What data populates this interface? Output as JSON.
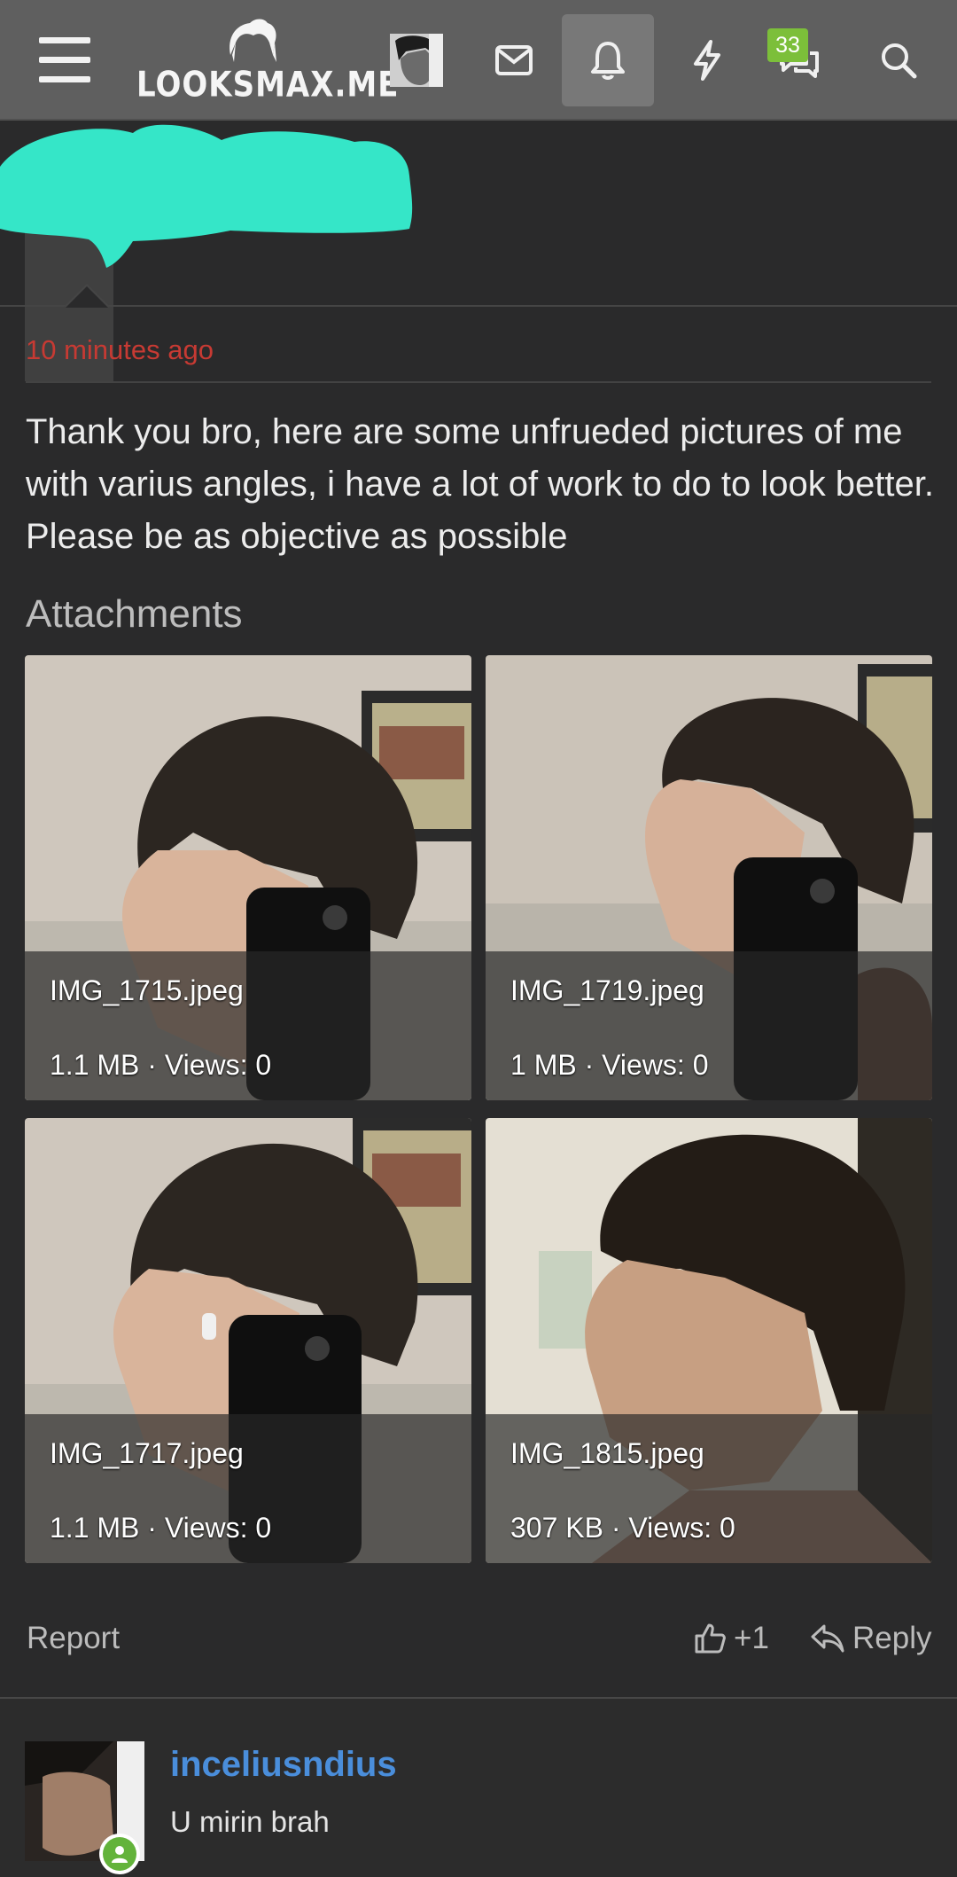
{
  "app": {
    "logo_text": "LOOKSMAX.ME"
  },
  "nav": {
    "icons": [
      "menu-icon",
      "user-avatar",
      "mail-icon",
      "bell-icon",
      "lightning-icon",
      "chat-icon",
      "search-icon"
    ],
    "chat_badge": "33"
  },
  "post": {
    "time": "10 minutes ago",
    "body": "Thank you bro, here are some unfrueded pictures of me with varius angles, i have a lot of work to do to look better. Please be as objective as possible",
    "attachments_title": "Attachments",
    "attachments": [
      {
        "name": "IMG_1715.jpeg",
        "size": "1.1 MB · Views: 0"
      },
      {
        "name": "IMG_1719.jpeg",
        "size": "1 MB · Views: 0"
      },
      {
        "name": "IMG_1717.jpeg",
        "size": "1.1 MB · Views: 0"
      },
      {
        "name": "IMG_1815.jpeg",
        "size": "307 KB · Views: 0"
      }
    ],
    "actions": {
      "report": "Report",
      "like": "+1",
      "reply": "Reply"
    }
  },
  "comment": {
    "username": "inceliusndius",
    "text": "U mirin brah"
  },
  "colors": {
    "accent_red": "#c73a33",
    "username_blue": "#4a8edb",
    "badge_green": "#7cbf3a",
    "redaction": "#35e6c8"
  }
}
